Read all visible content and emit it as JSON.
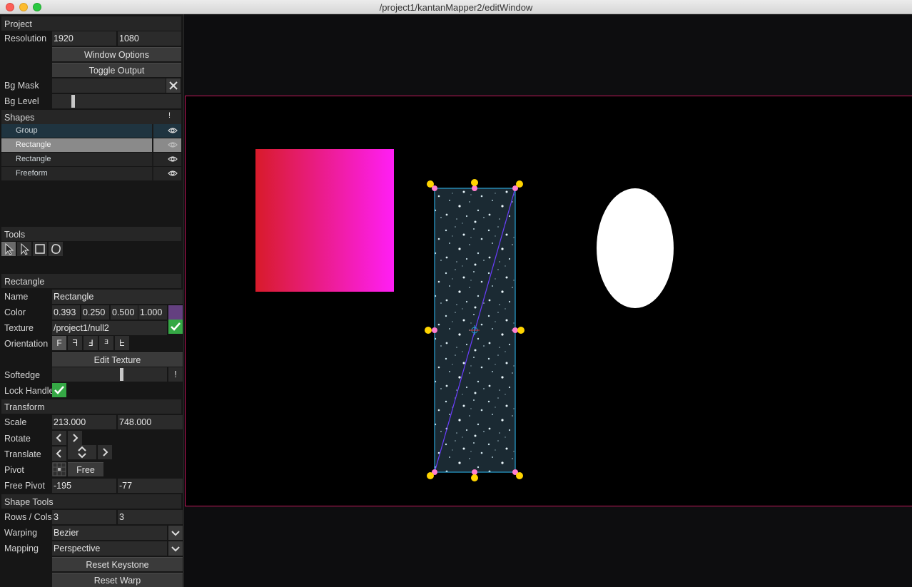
{
  "window": {
    "title": "/project1/kantanMapper2/editWindow"
  },
  "project": {
    "header": "Project",
    "resolution_label": "Resolution",
    "res_w": "1920",
    "res_h": "1080",
    "window_options": "Window Options",
    "toggle_output": "Toggle Output",
    "bg_mask_label": "Bg Mask",
    "bg_level_label": "Bg Level",
    "bg_level_value": 0.15
  },
  "shapes": {
    "header": "Shapes",
    "header_btn": "!",
    "items": [
      {
        "label": "Group",
        "state": "group"
      },
      {
        "label": "Rectangle",
        "state": "selected"
      },
      {
        "label": "Rectangle",
        "state": "normal"
      },
      {
        "label": "Freeform",
        "state": "normal"
      }
    ]
  },
  "tools": {
    "header": "Tools",
    "items": [
      "select-arrow-icon",
      "direct-select-icon",
      "rectangle-tool-icon",
      "freeform-tool-icon"
    ]
  },
  "rectangle": {
    "header": "Rectangle",
    "name_label": "Name",
    "name": "Rectangle",
    "color_label": "Color",
    "color_r": "0.393",
    "color_g": "0.250",
    "color_b": "0.500",
    "color_a": "1.000",
    "swatch": "#644080",
    "texture_label": "Texture",
    "texture": "/project1/null2",
    "orientation_label": "Orientation",
    "orientation_glyphs": [
      "F",
      "ᖷ",
      "Ⅎ",
      "ᴲ",
      "ᖶ"
    ],
    "edit_texture": "Edit Texture",
    "softedge_label": "Softedge",
    "softedge_value": 0.59,
    "softedge_btn": "!",
    "lock_label": "Lock Handle"
  },
  "transform": {
    "header": "Transform",
    "scale_label": "Scale",
    "scale_x": "213.000",
    "scale_y": "748.000",
    "rotate_label": "Rotate",
    "translate_label": "Translate",
    "pivot_label": "Pivot",
    "pivot_mode": "Free",
    "free_pivot_label": "Free Pivot",
    "free_pivot_x": "-195",
    "free_pivot_y": "-77"
  },
  "shape_tools": {
    "header": "Shape Tools",
    "rows_cols_label": "Rows / Cols",
    "rows": "3",
    "cols": "3",
    "warping_label": "Warping",
    "warping": "Bezier",
    "mapping_label": "Mapping",
    "mapping": "Perspective",
    "reset_keystone": "Reset Keystone",
    "reset_warp": "Reset Warp"
  },
  "colors": {
    "stage_border": "#c2185b",
    "gradient_start": "#d81b2a",
    "gradient_end": "#ff1ef5",
    "handle_corner": "#ffd400",
    "handle_edge": "#ff7fd0",
    "outline": "#2aa3d6",
    "diagonal": "#6a3dff"
  }
}
